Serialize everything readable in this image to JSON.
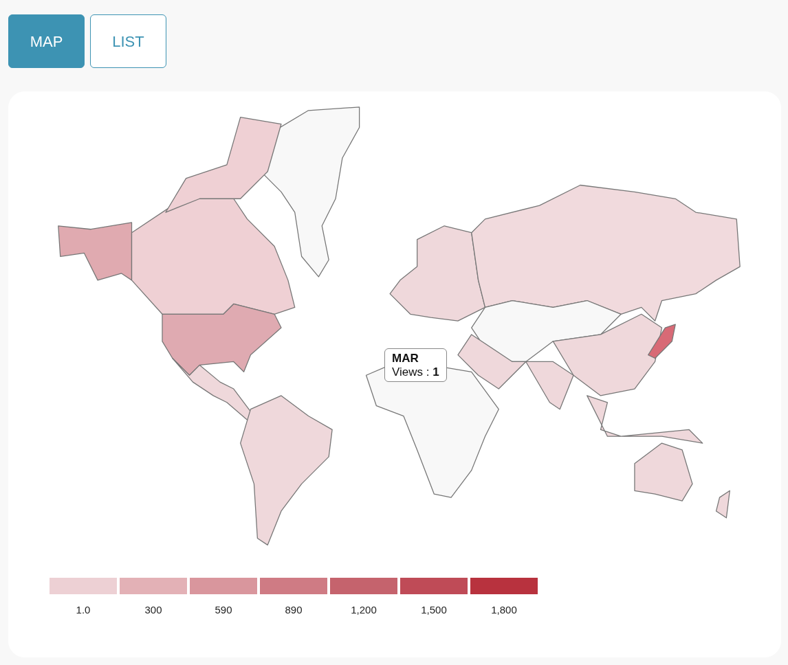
{
  "view_tabs": [
    {
      "label": "MAP",
      "selected": true
    },
    {
      "label": "LIST",
      "selected": false
    }
  ],
  "map": {
    "tooltip": {
      "title": "MAR",
      "text": "Views : **1**"
    },
    "legend": [
      {
        "label": "1.0",
        "color": "#edd0d4"
      },
      {
        "label": "300",
        "color": "#e3b1b6"
      },
      {
        "label": "590",
        "color": "#d9969d"
      },
      {
        "label": "890",
        "color": "#cf7b84"
      },
      {
        "label": "1,200",
        "color": "#c5636d"
      },
      {
        "label": "1,500",
        "color": "#bf4b57"
      },
      {
        "label": "1,800",
        "color": "#b8323e"
      }
    ]
  }
}
